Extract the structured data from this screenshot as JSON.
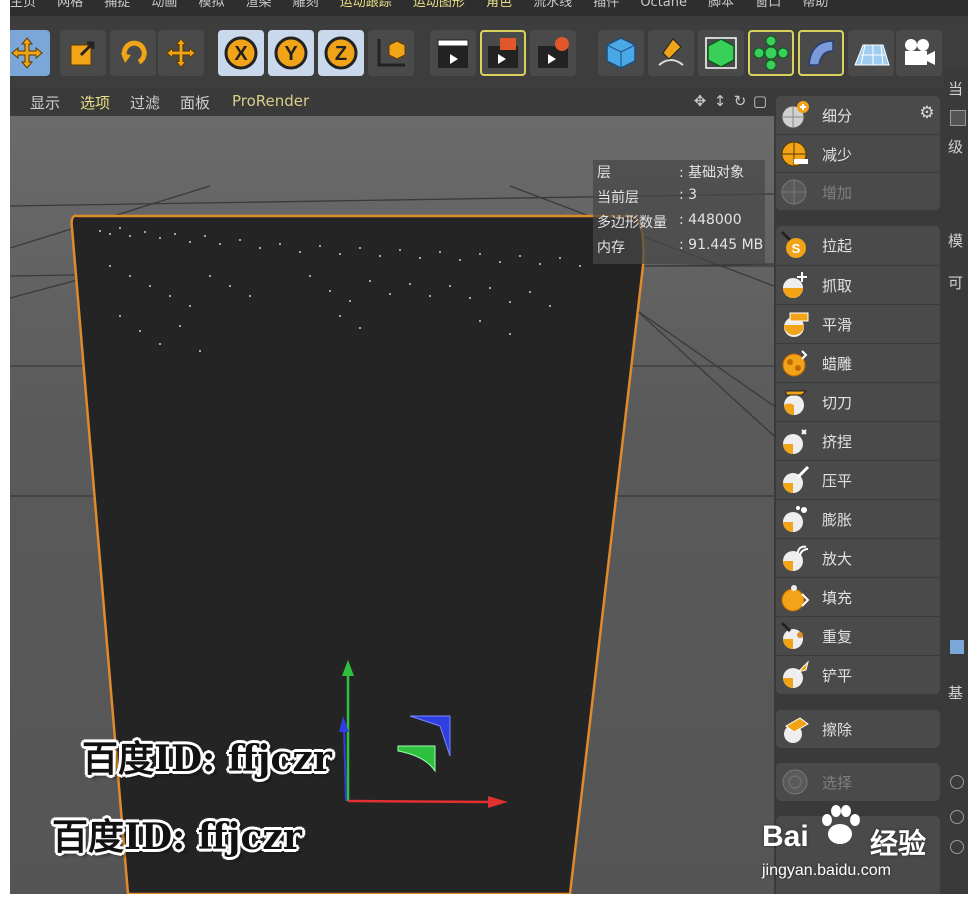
{
  "menu": [
    "主页",
    "网格",
    "捕捉",
    "动画",
    "模拟",
    "渲染",
    "雕刻",
    "运动跟踪",
    "运动图形",
    "角色",
    "流水线",
    "插件",
    "Octane",
    "脚本",
    "窗口",
    "帮助"
  ],
  "view_menu": [
    "显示",
    "选项",
    "过滤",
    "面板",
    "ProRender"
  ],
  "hud": {
    "rows": [
      {
        "key": "层",
        "value": ": 基础对象"
      },
      {
        "key": "当前层",
        "value": ": 3"
      },
      {
        "key": "多边形数量",
        "value": ": 448000"
      },
      {
        "key": "内存",
        "value": ": 91.445 MB"
      }
    ]
  },
  "sculpt_tools": {
    "group1": [
      {
        "label": "细分",
        "icon": "subdivide-icon",
        "disabled": false
      },
      {
        "label": "减少",
        "icon": "decrease-icon",
        "disabled": false
      },
      {
        "label": "增加",
        "icon": "increase-icon",
        "disabled": true
      }
    ],
    "group2": [
      {
        "label": "拉起",
        "icon": "pull-brush-icon"
      },
      {
        "label": "抓取",
        "icon": "grab-brush-icon"
      },
      {
        "label": "平滑",
        "icon": "smooth-brush-icon"
      },
      {
        "label": "蜡雕",
        "icon": "wax-brush-icon"
      },
      {
        "label": "切刀",
        "icon": "knife-brush-icon"
      },
      {
        "label": "挤捏",
        "icon": "pinch-brush-icon"
      },
      {
        "label": "压平",
        "icon": "flatten-brush-icon"
      },
      {
        "label": "膨胀",
        "icon": "inflate-brush-icon"
      },
      {
        "label": "放大",
        "icon": "magnify-brush-icon"
      },
      {
        "label": "填充",
        "icon": "fill-brush-icon"
      },
      {
        "label": "重复",
        "icon": "repeat-brush-icon"
      },
      {
        "label": "铲平",
        "icon": "scrape-brush-icon"
      }
    ],
    "group3": [
      {
        "label": "擦除",
        "icon": "erase-brush-icon"
      }
    ],
    "group4": [
      {
        "label": "选择",
        "icon": "select-brush-icon",
        "disabled": true
      }
    ]
  },
  "right_panel": {
    "labels": [
      "当",
      "级",
      "模",
      "可",
      "基"
    ]
  },
  "watermark": {
    "text1": "百度ID: ffjczr",
    "text2": "百度ID: ffjczr"
  },
  "baidu": {
    "brand": "Bai",
    "brand2": "经验",
    "url": "jingyan.baidu.com"
  },
  "colors": {
    "accent": "#7aa6d8",
    "highlight": "#d9d35c",
    "object_outline": "#e08a2a",
    "axis_x": "#e03030",
    "axis_y": "#30c040",
    "axis_z": "#3040e0"
  }
}
